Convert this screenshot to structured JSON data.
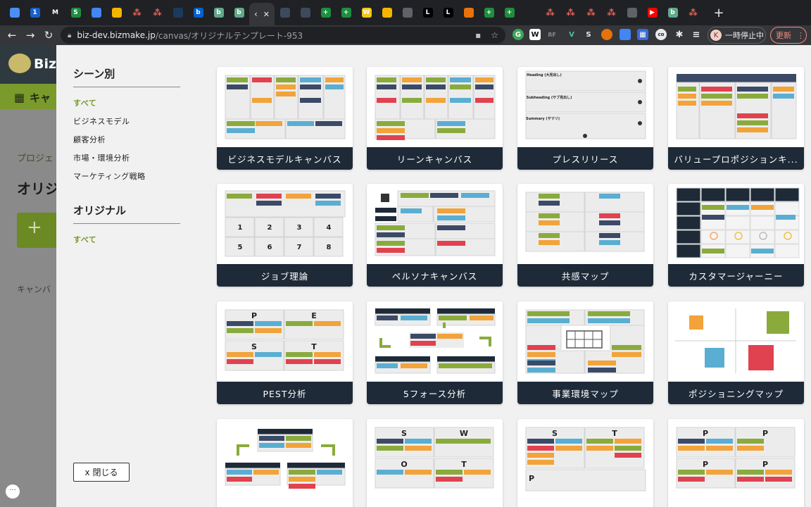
{
  "browser": {
    "tabs_left": [
      {
        "icon": "docs-icon",
        "color": "#4a8ff7",
        "letter": ""
      },
      {
        "icon": "1password-icon",
        "color": "#1a60c8",
        "letter": "1"
      },
      {
        "icon": "gmail-icon",
        "color": "#202124",
        "letter": "M"
      },
      {
        "icon": "sheets-icon",
        "color": "#1e8e3e",
        "letter": "S"
      },
      {
        "icon": "docs-icon",
        "color": "#4285f4",
        "letter": ""
      },
      {
        "icon": "drive-icon",
        "color": "#f4b400",
        "letter": ""
      },
      {
        "icon": "asana-icon",
        "color": "asana",
        "letter": "⁂"
      },
      {
        "icon": "asana-icon",
        "color": "asana",
        "letter": "⁂"
      },
      {
        "icon": "wordpress-icon",
        "color": "#1b3a5c",
        "letter": ""
      },
      {
        "icon": "box-icon",
        "color": "#0061d5",
        "letter": "b"
      },
      {
        "icon": "bizmake-icon",
        "color": "#62a88a",
        "letter": "b"
      },
      {
        "icon": "bizmake-icon",
        "color": "#62a88a",
        "letter": "b"
      }
    ],
    "active_tab_label": "‹",
    "tabs_right": [
      {
        "icon": "shield-icon",
        "color": "#3c4a5c",
        "letter": ""
      },
      {
        "icon": "shield-icon",
        "color": "#3c4a5c",
        "letter": ""
      },
      {
        "icon": "plus-green-icon",
        "color": "#1e8e3e",
        "letter": "+"
      },
      {
        "icon": "plus-green-icon",
        "color": "#1e8e3e",
        "letter": "+"
      },
      {
        "icon": "miro-icon",
        "color": "#f5c518",
        "letter": "W"
      },
      {
        "icon": "slides-icon",
        "color": "#f4b400",
        "letter": ""
      },
      {
        "icon": "globe-icon",
        "color": "#5f6368",
        "letter": ""
      },
      {
        "icon": "L-icon",
        "color": "#000000",
        "letter": "L"
      },
      {
        "icon": "L-icon",
        "color": "#000000",
        "letter": "L"
      },
      {
        "icon": "cube-icon",
        "color": "#e8710a",
        "letter": ""
      },
      {
        "icon": "plus-green-icon",
        "color": "#1e8e3e",
        "letter": "+"
      },
      {
        "icon": "plus-green-icon",
        "color": "#1e8e3e",
        "letter": "+"
      },
      {
        "icon": "bulb-icon",
        "color": "#202124",
        "letter": ""
      },
      {
        "icon": "asana-icon",
        "color": "asana",
        "letter": "⁂"
      },
      {
        "icon": "asana-icon",
        "color": "asana",
        "letter": "⁂"
      },
      {
        "icon": "asana-icon",
        "color": "asana",
        "letter": "⁂"
      },
      {
        "icon": "asana-icon",
        "color": "asana",
        "letter": "⁂"
      },
      {
        "icon": "car-icon",
        "color": "#5f6368",
        "letter": ""
      },
      {
        "icon": "youtube-icon",
        "color": "#ff0000",
        "letter": "▶"
      },
      {
        "icon": "bizmake-icon",
        "color": "#62a88a",
        "letter": "b"
      },
      {
        "icon": "asana-icon",
        "color": "asana",
        "letter": "⁂"
      }
    ],
    "url_host": "biz-dev.bizmake.jp",
    "url_path": "/canvas/オリジナルテンプレート-953",
    "paused_label": "一時停止中",
    "avatar_letter": "K",
    "update_label": "更新"
  },
  "background_app": {
    "logo_text": "Biz",
    "nav_label": "キャ",
    "breadcrumb": "プロジェ",
    "title": "オリジ",
    "add_symbol": "+",
    "canvas_label": "キャンバ",
    "chat_symbol": "···"
  },
  "modal": {
    "scene_heading": "シーン別",
    "scene_items": [
      "すべて",
      "ビジネスモデル",
      "顧客分析",
      "市場・環境分析",
      "マーケティング戦略"
    ],
    "original_heading": "オリジナル",
    "original_items": [
      "すべて"
    ],
    "close_label": "x 閉じる",
    "templates": [
      {
        "id": "bmc",
        "title": "ビジネスモデルキャンバス"
      },
      {
        "id": "lean",
        "title": "リーンキャンバス"
      },
      {
        "id": "press",
        "title": "プレスリリース"
      },
      {
        "id": "vpc",
        "title": "バリュープロポジションキ..."
      },
      {
        "id": "job",
        "title": "ジョブ理論"
      },
      {
        "id": "persona",
        "title": "ペルソナキャンバス"
      },
      {
        "id": "empathy",
        "title": "共感マップ"
      },
      {
        "id": "journey",
        "title": "カスタマージャーニー"
      },
      {
        "id": "pest",
        "title": "PEST分析"
      },
      {
        "id": "fiveforce",
        "title": "5フォース分析"
      },
      {
        "id": "envmap",
        "title": "事業環境マップ"
      },
      {
        "id": "positioning",
        "title": "ポジショニングマップ"
      },
      {
        "id": "flow",
        "title": ""
      },
      {
        "id": "swot",
        "title": ""
      },
      {
        "id": "stp",
        "title": ""
      },
      {
        "id": "fourp",
        "title": ""
      }
    ],
    "thumb_text": {
      "press_heading": "Heading (大見出し)",
      "press_subheading": "Subheading (サブ見出し)",
      "press_summary": "Summary (サマリ)",
      "job_numbers": [
        "1",
        "2",
        "3",
        "4",
        "5",
        "6",
        "7",
        "8"
      ],
      "pest_letters": [
        "P",
        "E",
        "S",
        "T"
      ],
      "swot_letters": [
        "S",
        "W",
        "O",
        "T"
      ],
      "stp_letters": [
        "S",
        "T",
        "P"
      ],
      "fourp_letters": [
        "P",
        "P",
        "P",
        "P"
      ]
    }
  },
  "colors": {
    "green": "#8aab3c",
    "red": "#e0424f",
    "orange": "#f2a33a",
    "blue": "#5aaed2",
    "navy": "#3b4a66",
    "dark": "#1e2a38",
    "selected_green": "#7a9a2c"
  }
}
